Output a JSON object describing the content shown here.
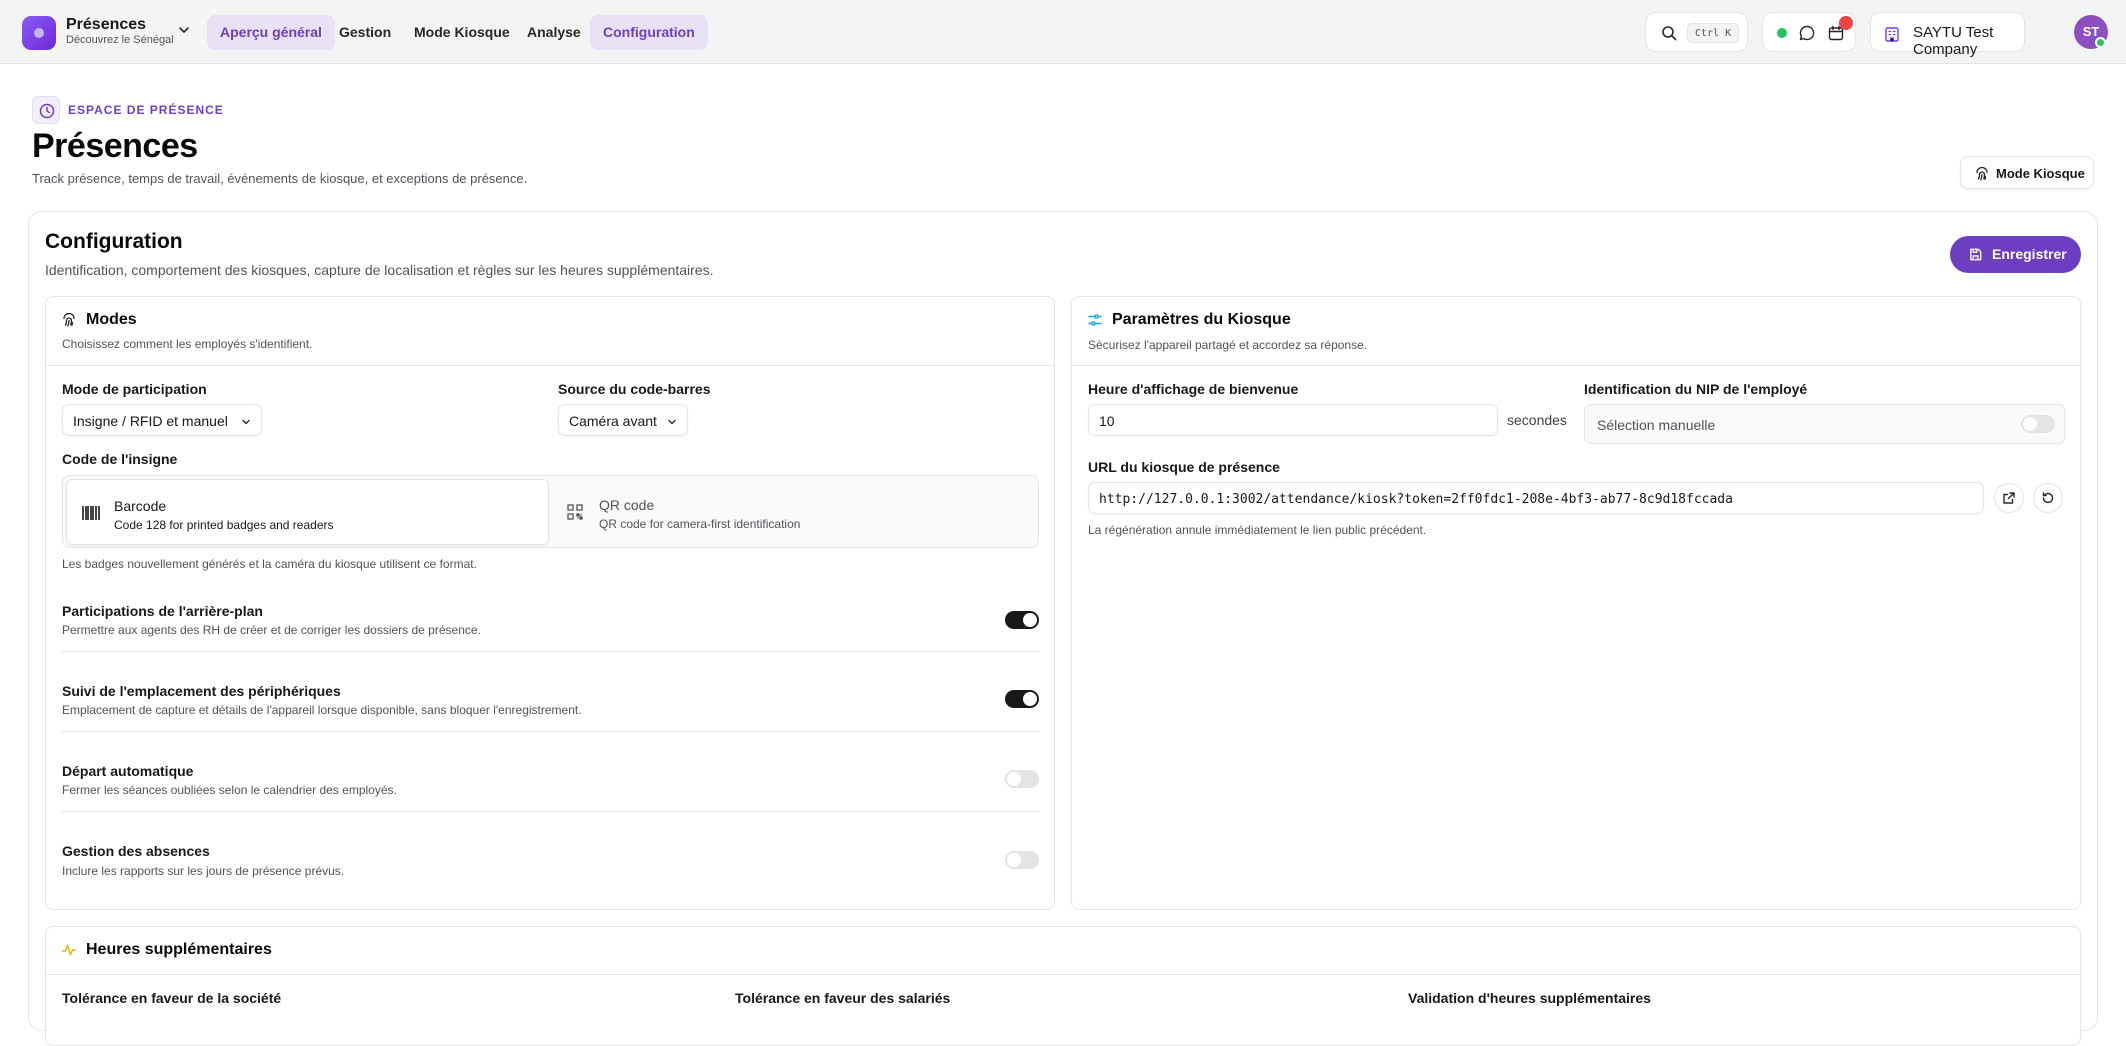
{
  "app": {
    "name": "Présences",
    "subtitle": "Découvrez le Sénégal"
  },
  "nav": [
    {
      "label": "Aperçu général",
      "state": "active"
    },
    {
      "label": "Gestion",
      "state": ""
    },
    {
      "label": "Mode Kiosque",
      "state": ""
    },
    {
      "label": "Analyse",
      "state": ""
    },
    {
      "label": "Configuration",
      "state": "selected"
    }
  ],
  "search": {
    "shortcut": "Ctrl K"
  },
  "company": {
    "name": "SAYTU Test Company"
  },
  "user": {
    "initials": "ST"
  },
  "header": {
    "eyebrow": "ESPACE DE PRÉSENCE",
    "title": "Présences",
    "description": "Track présence, temps de travail, événements de kiosque, et exceptions de présence.",
    "kiosk_button": "Mode Kiosque"
  },
  "config": {
    "title": "Configuration",
    "description": "Identification, comportement des kiosques, capture de localisation et règles sur les heures supplémentaires.",
    "save_button": "Enregistrer"
  },
  "modes": {
    "title": "Modes",
    "description": "Choisissez comment les employés s'identifient.",
    "participation_label": "Mode de participation",
    "participation_value": "Insigne / RFID et manuel",
    "barcode_source_label": "Source du code-barres",
    "barcode_source_value": "Caméra avant",
    "badge_code_label": "Code de l'insigne",
    "badge_options": [
      {
        "title": "Barcode",
        "subtitle": "Code 128 for printed badges and readers",
        "selected": true
      },
      {
        "title": "QR code",
        "subtitle": "QR code for camera-first identification",
        "selected": false
      }
    ],
    "badge_hint": "Les badges nouvellement générés et la caméra du kiosque utilisent ce format.",
    "settings": [
      {
        "title": "Participations de l'arrière-plan",
        "description": "Permettre aux agents des RH de créer et de corriger les dossiers de présence.",
        "enabled": true
      },
      {
        "title": "Suivi de l'emplacement des périphériques",
        "description": "Emplacement de capture et détails de l'appareil lorsque disponible, sans bloquer l'enregistrement.",
        "enabled": true
      },
      {
        "title": "Départ automatique",
        "description": "Fermer les séances oubliées selon le calendrier des employés.",
        "enabled": false
      },
      {
        "title": "Gestion des absences",
        "description": "Inclure les rapports sur les jours de présence prévus.",
        "enabled": false
      }
    ]
  },
  "kiosk": {
    "title": "Paramètres du Kiosque",
    "description": "Sécurisez l'appareil partagé et accordez sa réponse.",
    "welcome_label": "Heure d'affichage de bienvenue",
    "welcome_value": "10",
    "welcome_unit": "secondes",
    "pin_label": "Identification du NIP de l'employé",
    "pin_value": "Sélection manuelle",
    "pin_enabled": false,
    "url_label": "URL du kiosque de présence",
    "url_value": "http://127.0.0.1:3002/attendance/kiosk?token=2ff0fdc1-208e-4bf3-ab77-8c9d18fccada",
    "url_hint": "La régénération annule immédiatement le lien public précédent."
  },
  "overtime": {
    "title": "Heures supplémentaires",
    "labels": [
      "Tolérance en faveur de la société",
      "Tolérance en faveur des salariés",
      "Validation d'heures supplémentaires"
    ]
  },
  "colors": {
    "accent": "#6d3fc0",
    "accent_soft": "#e9e1f6",
    "toggle_on": "#18181b",
    "status_online": "#22c55e",
    "notification": "#ef4444"
  }
}
